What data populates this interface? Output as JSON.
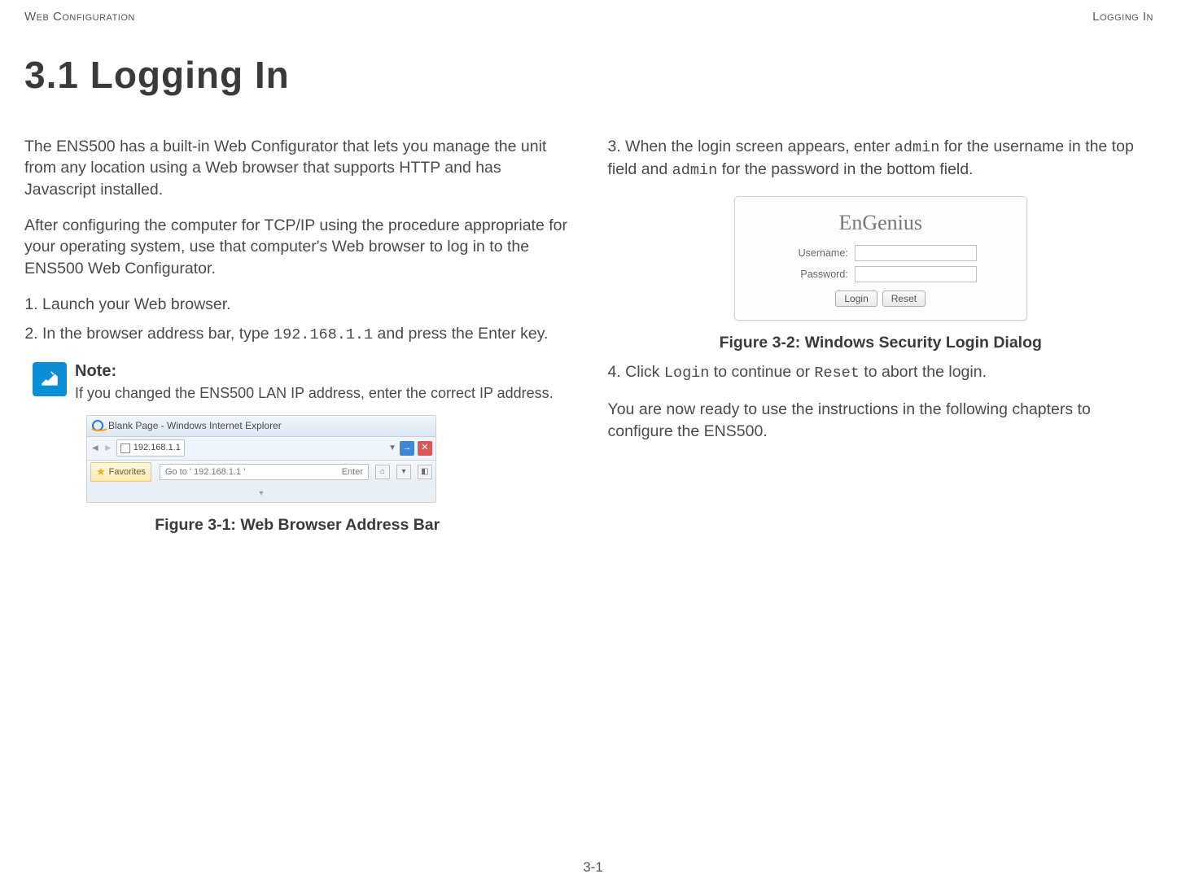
{
  "header": {
    "left": "Web Configuration",
    "right": "Logging In"
  },
  "title": "3.1 Logging In",
  "left_col": {
    "p1": "The ENS500 has a built-in Web Configurator that lets you manage the unit from any location using a Web browser that supports HTTP and has Javascript installed.",
    "p2": "After configuring the computer for TCP/IP using the procedure appropriate for your operating system, use that computer's Web browser to log in to the ENS500 Web Configurator.",
    "steps": {
      "s1": "Launch your Web browser.",
      "s2_pre": "In the browser address bar, type ",
      "s2_code": "192.168.1.1",
      "s2_post": " and press the Enter key."
    },
    "note": {
      "title": "Note:",
      "body": "If you changed the ENS500 LAN IP address, enter the correct IP address."
    },
    "browser": {
      "window_title": "Blank Page - Windows Internet Explorer",
      "url_text": "192.168.1.1",
      "fav_label": "Favorites",
      "goto_prefix": "Go to ' ",
      "goto_url": "192.168.1.1",
      "goto_suffix": " '",
      "enter_text": "Enter"
    },
    "fig_caption": "Figure 3-1: Web Browser Address Bar"
  },
  "right_col": {
    "p1_pre": "3. When the login screen appears, enter ",
    "p1_c1": "admin",
    "p1_mid": " for the username in the top field and ",
    "p1_c2": "admin",
    "p1_post": " for the password in the bottom field.",
    "login": {
      "brand": "EnGenius",
      "username_label": "Username:",
      "password_label": "Password:",
      "login_btn": "Login",
      "reset_btn": "Reset"
    },
    "fig_caption": "Figure 3-2: Windows Security Login Dialog",
    "p2_pre": "4. Click ",
    "p2_c1": "Login",
    "p2_mid": " to continue or ",
    "p2_c2": "Reset",
    "p2_post": " to abort the login.",
    "p3": "You are now ready to use the instructions in the following chapters to configure the ENS500."
  },
  "page_num": "3-1"
}
